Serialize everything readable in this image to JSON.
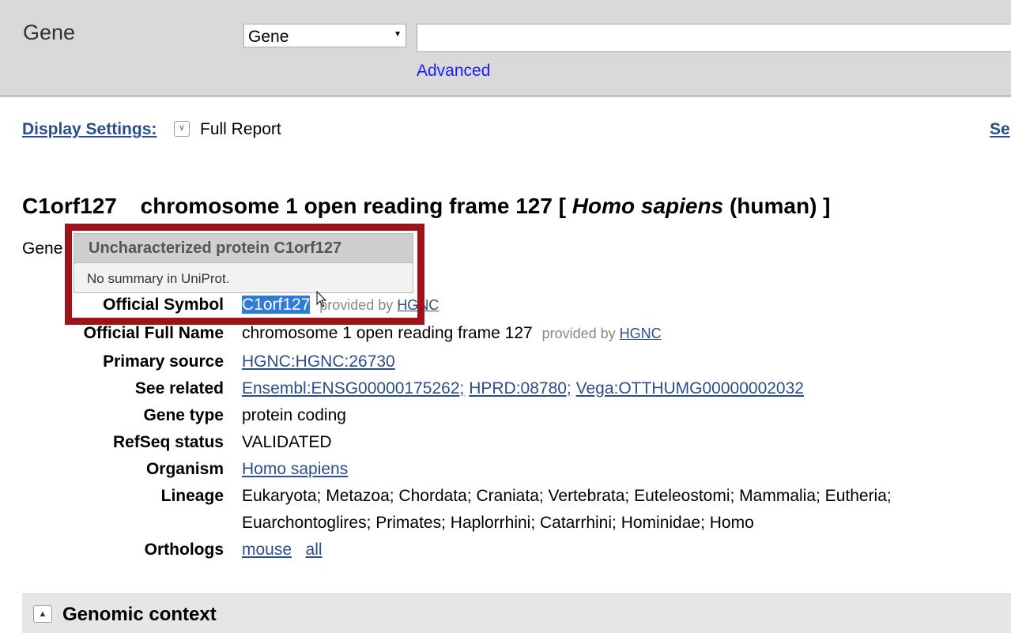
{
  "header": {
    "db_title": "Gene",
    "db_select_value": "Gene",
    "search_value": "",
    "advanced_label": "Advanced"
  },
  "display": {
    "settings_label": "Display Settings:",
    "mode": "Full Report",
    "right_link": "Se"
  },
  "title": {
    "symbol": "C1orf127",
    "description": "chromosome 1 open reading frame 127 [",
    "species": "Homo sapiens",
    "common": "(human) ]"
  },
  "gene_id_label": "Gene",
  "tooltip": {
    "title": "Uncharacterized protein C1orf127",
    "body": "No summary in UniProt."
  },
  "details": {
    "official_symbol": {
      "label": "Official Symbol",
      "value": "C1orf127",
      "provided": "provided by",
      "source": "HGNC"
    },
    "official_full_name": {
      "label": "Official Full Name",
      "value": "chromosome 1 open reading frame 127",
      "provided": "provided by",
      "source": "HGNC"
    },
    "primary_source": {
      "label": "Primary source",
      "value": "HGNC:HGNC:26730"
    },
    "see_related": {
      "label": "See related",
      "links": [
        "Ensembl:ENSG00000175262;",
        "HPRD:08780;",
        "Vega:OTTHUMG00000002032"
      ]
    },
    "gene_type": {
      "label": "Gene type",
      "value": "protein coding"
    },
    "refseq_status": {
      "label": "RefSeq status",
      "value": "VALIDATED"
    },
    "organism": {
      "label": "Organism",
      "value": "Homo sapiens"
    },
    "lineage": {
      "label": "Lineage",
      "line1": "Eukaryota; Metazoa; Chordata; Craniata; Vertebrata; Euteleostomi; Mammalia; Eutheria;",
      "line2": "Euarchontoglires; Primates; Haplorrhini; Catarrhini; Hominidae; Homo"
    },
    "orthologs": {
      "label": "Orthologs",
      "links": [
        "mouse",
        "all"
      ]
    }
  },
  "section": {
    "title": "Genomic context"
  }
}
